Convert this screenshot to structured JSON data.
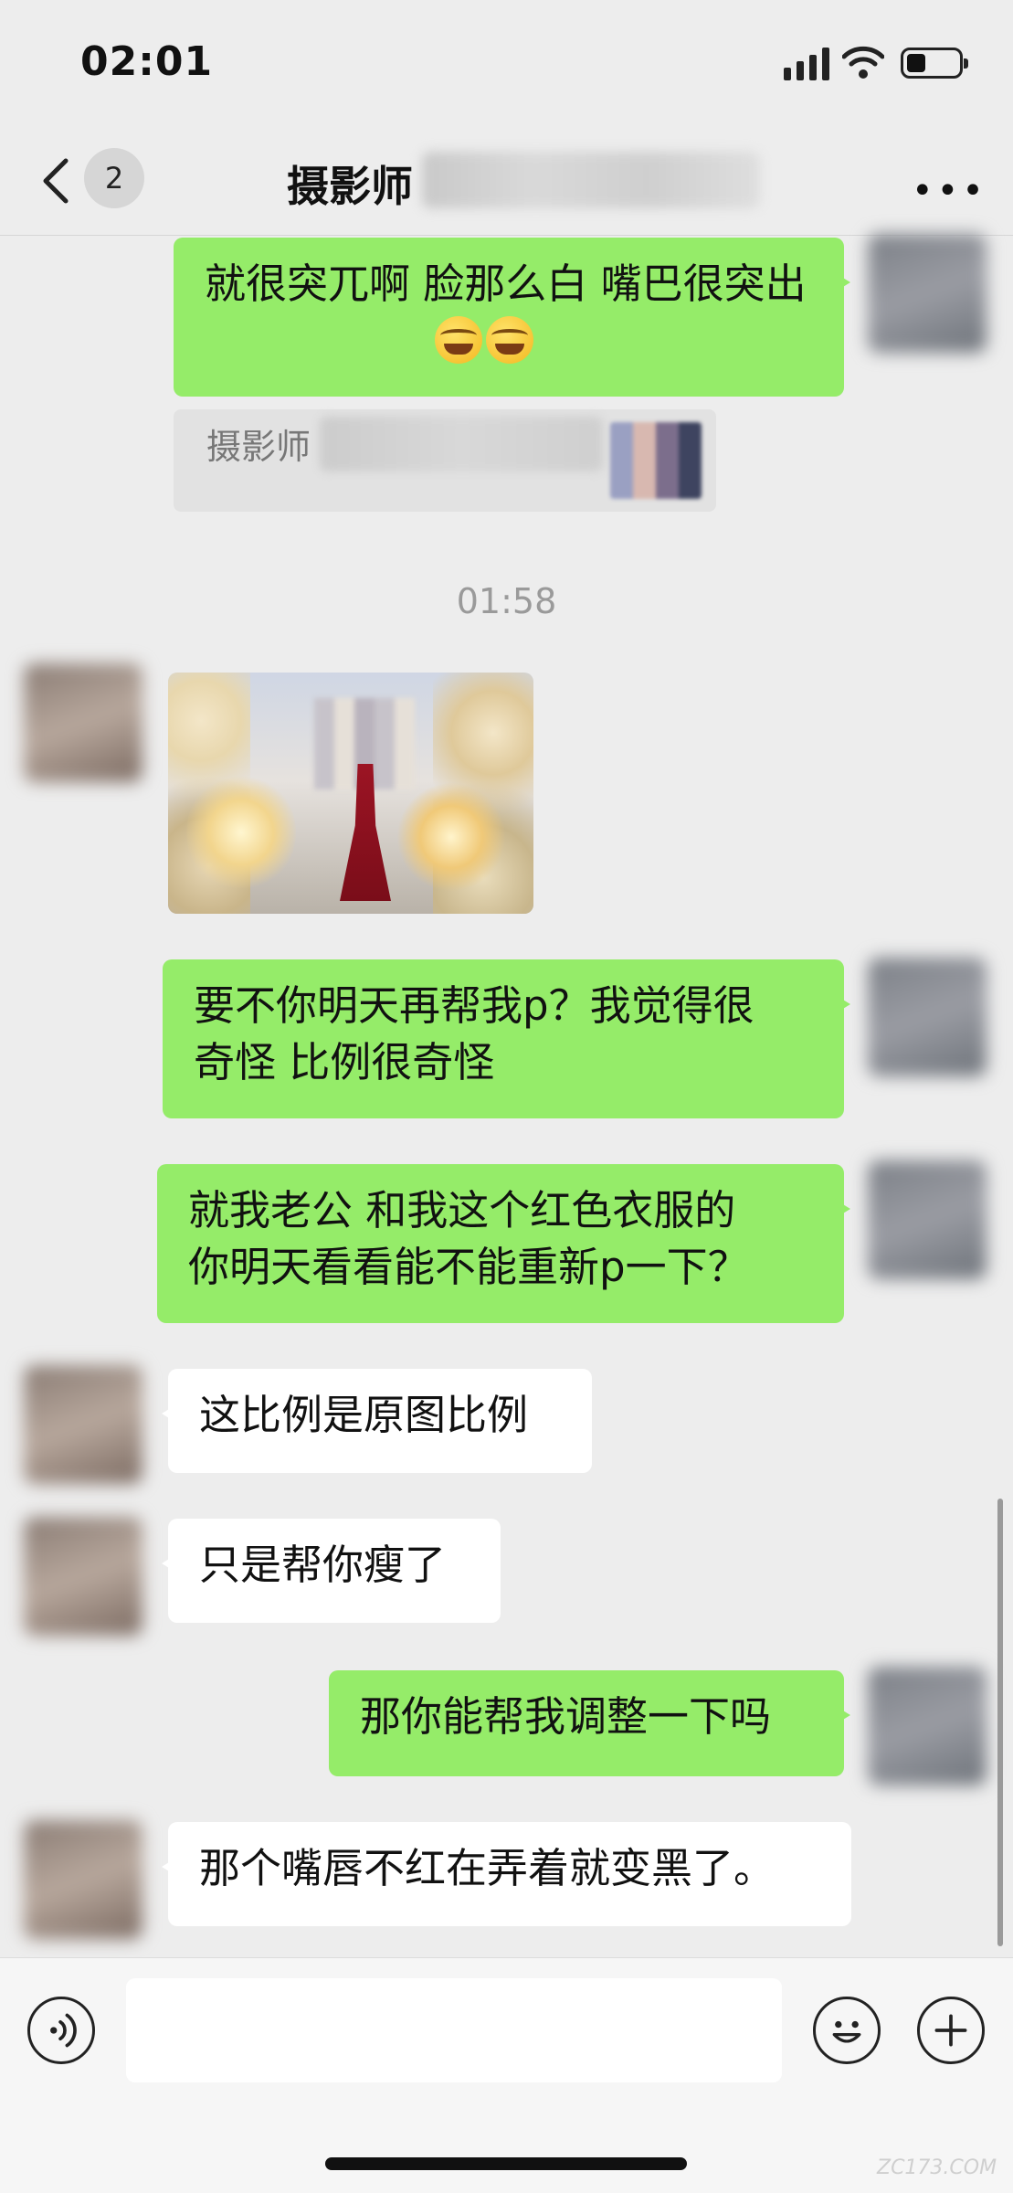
{
  "status_bar": {
    "time": "02:01",
    "icons": [
      "signal-icon",
      "wifi-icon",
      "battery-icon"
    ]
  },
  "header": {
    "back_count": "2",
    "title": "摄影师",
    "more_icon": "more-icon"
  },
  "messages": [
    {
      "side": "right",
      "type": "text",
      "text": "就很突兀啊 脸那么白 嘴巴很突出",
      "text_line2": "出",
      "emoji": "laughing-crying-emoji x2"
    },
    {
      "side": "right",
      "type": "quote",
      "quote_name": "摄影师"
    },
    {
      "type": "timestamp",
      "text": "01:58"
    },
    {
      "side": "left",
      "type": "image"
    },
    {
      "side": "right",
      "type": "text",
      "line1": "要不你明天再帮我p？我觉得很",
      "line2": "奇怪 比例很奇怪"
    },
    {
      "side": "right",
      "type": "text",
      "line1": "就我老公 和我这个红色衣服的",
      "line2": "你明天看看能不能重新p一下？"
    },
    {
      "side": "left",
      "type": "text",
      "text": "这比例是原图比例"
    },
    {
      "side": "left",
      "type": "text",
      "text": "只是帮你瘦了"
    },
    {
      "side": "right",
      "type": "text",
      "text": "那你能帮我调整一下吗"
    },
    {
      "side": "left",
      "type": "text",
      "text": "那个嘴唇不红在弄着就变黑了。"
    }
  ],
  "input_bar": {
    "voice_icon": "voice-icon",
    "emoji_icon": "emoji-icon",
    "plus_icon": "plus-icon",
    "placeholder": ""
  },
  "watermark": "ZC173.COM",
  "colors": {
    "background": "#ededed",
    "sent_bubble": "#95ec69",
    "received_bubble": "#ffffff"
  }
}
